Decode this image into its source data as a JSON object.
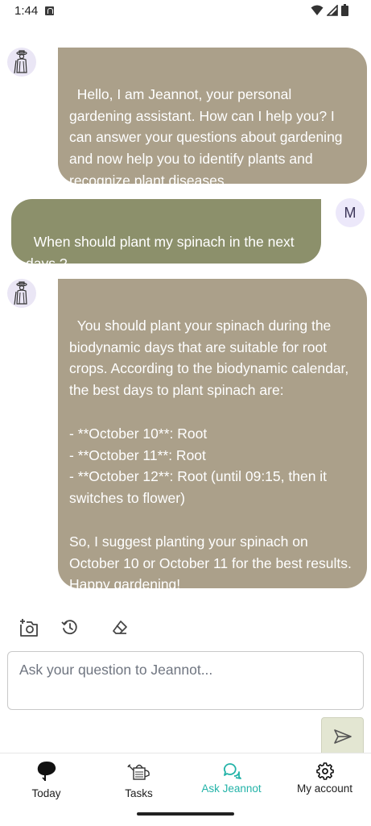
{
  "status_bar": {
    "time": "1:44"
  },
  "messages": [
    {
      "sender": "bot",
      "text": "Hello, I am Jeannot, your personal gardening assistant. How can I help you? I can answer your questions about gardening and now help you to identify plants and recognize plant diseases."
    },
    {
      "sender": "user",
      "avatar_letter": "M",
      "text": "When should plant my spinach in the next days ?"
    },
    {
      "sender": "bot",
      "text": "You should plant your spinach during the biodynamic days that are suitable for root crops. According to the biodynamic calendar, the best days to plant spinach are:\n\n- **October 10**: Root\n- **October 11**: Root\n- **October 12**: Root (until 09:15, then it switches to flower)\n\nSo, I suggest planting your spinach on October 10 or October 11 for the best results. Happy gardening!"
    }
  ],
  "toolbar": {
    "icons": [
      "add-photo-icon",
      "history-icon",
      "eraser-icon"
    ]
  },
  "input": {
    "placeholder": "Ask your question to Jeannot...",
    "value": ""
  },
  "send_button": {
    "icon": "send-icon",
    "color": "#e3e6d2"
  },
  "bottom_nav": {
    "items": [
      {
        "label": "Today",
        "icon": "leaf-icon",
        "active": false
      },
      {
        "label": "Tasks",
        "icon": "watering-can-icon",
        "active": false
      },
      {
        "label": "Ask Jeannot",
        "icon": "chat-icon",
        "active": true
      },
      {
        "label": "My account",
        "icon": "gear-icon",
        "active": false
      }
    ],
    "active_color": "#23b3a8"
  },
  "colors": {
    "bot_bubble": "#aba08a",
    "user_bubble": "#8c906b",
    "avatar_bg": "#eae6f5"
  }
}
